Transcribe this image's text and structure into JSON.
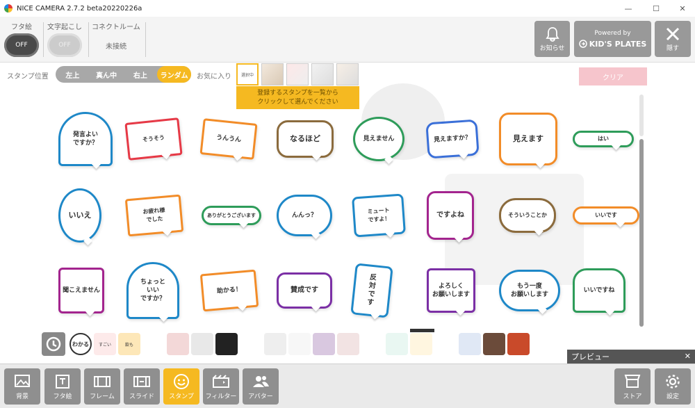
{
  "window": {
    "title": "NICE CAMERA 2.7.2 beta20220226a",
    "min": "—",
    "max": "☐",
    "close": "✕"
  },
  "topbar": {
    "lid_label": "フタ絵",
    "lid_toggle": "OFF",
    "caption_label": "文字起こし",
    "caption_toggle": "OFF",
    "connect_label": "コネクトルーム",
    "connect_status": "未接続",
    "notice_label": "お知らせ",
    "powered_by": "Powered by",
    "kids_plates": "KID'S PLATES",
    "hide_label": "隠す"
  },
  "controls": {
    "position_label": "スタンプ位置",
    "positions": [
      "左上",
      "真ん中",
      "右上",
      "ランダム"
    ],
    "active_position": "ランダム",
    "favorites_label": "お気に入り",
    "favorites_placeholder": "選択中",
    "tooltip_line1": "登録するスタンプを一覧から",
    "tooltip_line2": "クリックして選んでください",
    "clear_label": "クリア"
  },
  "stamps": [
    {
      "text": "発言よい\nですか？",
      "color": "#1e88c8"
    },
    {
      "text": "そうそう",
      "color": "#e63946"
    },
    {
      "text": "うんうん",
      "color": "#f28c28"
    },
    {
      "text": "なるほど",
      "color": "#8b6b3d"
    },
    {
      "text": "見えません",
      "color": "#2e9c5a"
    },
    {
      "text": "見えますか？",
      "color": "#3a6fd8"
    },
    {
      "text": "見えます",
      "color": "#f28c28"
    },
    {
      "text": "はい",
      "color": "#2e9c5a"
    },
    {
      "text": "いいえ",
      "color": "#1e88c8"
    },
    {
      "text": "お疲れ様\nでした",
      "color": "#f28c28"
    },
    {
      "text": "ありがとうございます",
      "color": "#2e9c5a"
    },
    {
      "text": "んんっ？",
      "color": "#1e88c8"
    },
    {
      "text": "ミュート\nですよ！",
      "color": "#1e88c8"
    },
    {
      "text": "ですよね",
      "color": "#a3248e"
    },
    {
      "text": "そういうことか",
      "color": "#8b6b3d"
    },
    {
      "text": "いいです",
      "color": "#f28c28"
    },
    {
      "text": "聞こえません",
      "color": "#a3248e"
    },
    {
      "text": "ちょっと\nいい\nですか？",
      "color": "#1e88c8"
    },
    {
      "text": "助かる！",
      "color": "#f28c28"
    },
    {
      "text": "賛成です",
      "color": "#7b2fa5"
    },
    {
      "text": "反\n対\nで\nす",
      "color": "#1e88c8"
    },
    {
      "text": "よろしく\nお願いします",
      "color": "#7b2fa5"
    },
    {
      "text": "もう一度\nお願いします",
      "color": "#1e88c8"
    },
    {
      "text": "いいですね",
      "color": "#2e9c5a"
    }
  ],
  "tray": {
    "history_icon": "history-icon",
    "items": [
      "わかる",
      "すごい",
      "飲も",
      "",
      "",
      "",
      "",
      "",
      "",
      "",
      "",
      "",
      "",
      "",
      "",
      "",
      "",
      "",
      ""
    ]
  },
  "preview": {
    "label": "プレビュー",
    "close": "✕"
  },
  "nav": {
    "items": [
      {
        "label": "背景",
        "icon": "image-icon"
      },
      {
        "label": "フタ絵",
        "icon": "lid-icon"
      },
      {
        "label": "フレーム",
        "icon": "frame-icon"
      },
      {
        "label": "スライド",
        "icon": "slide-icon"
      },
      {
        "label": "スタンプ",
        "icon": "smile-icon"
      },
      {
        "label": "フィルター",
        "icon": "filter-icon"
      },
      {
        "label": "アバター",
        "icon": "avatar-icon"
      }
    ],
    "store": "ストア",
    "settings": "設定"
  },
  "colors": {
    "accent": "#f5b921",
    "button_gray": "#8f8f8f",
    "clear_pink": "#f6c5cc"
  }
}
